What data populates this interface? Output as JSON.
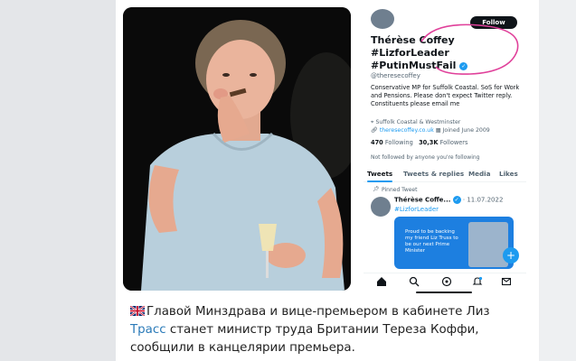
{
  "twitter": {
    "follow_label": "Follow",
    "name_line1": "Thérèse Coffey",
    "name_line2": "#LizforLeader",
    "name_line3": "#PutinMustFail",
    "handle": "@theresecoffey",
    "bio": "Conservative MP for Suffolk Coastal. SoS for Work and Pensions. Please don't expect Twitter reply. Constituents please email me",
    "location": "Suffolk Coastal & Westminster",
    "website": "theresecoffey.co.uk",
    "joined": "Joined June 2009",
    "following_count": "470",
    "following_label": "Following",
    "followers_count": "30,3K",
    "followers_label": "Followers",
    "not_followed": "Not followed by anyone you're following",
    "tabs": [
      "Tweets",
      "Tweets & replies",
      "Media",
      "Likes"
    ],
    "pinned_label": "Pinned Tweet",
    "pinned_name": "Thérèse Coffe...",
    "pinned_date": "· 11.07.2022",
    "pinned_hashtag": "#LizforLeader",
    "media_text": "Proud to be backing my friend Liz Truss to be our next Prime Minister",
    "fab_icon": "+"
  },
  "caption": {
    "part1": "Главой Минздрава и вице-премьером в кабинете Лиз ",
    "link": "Трасс",
    "part2": " станет министр труда Британии Тереза Коффи, сообщили в канцелярии премьера."
  },
  "colors": {
    "twitter_blue": "#1d9bf0",
    "annotation_pink": "#e0409a",
    "link_blue": "#2a7ab8"
  }
}
